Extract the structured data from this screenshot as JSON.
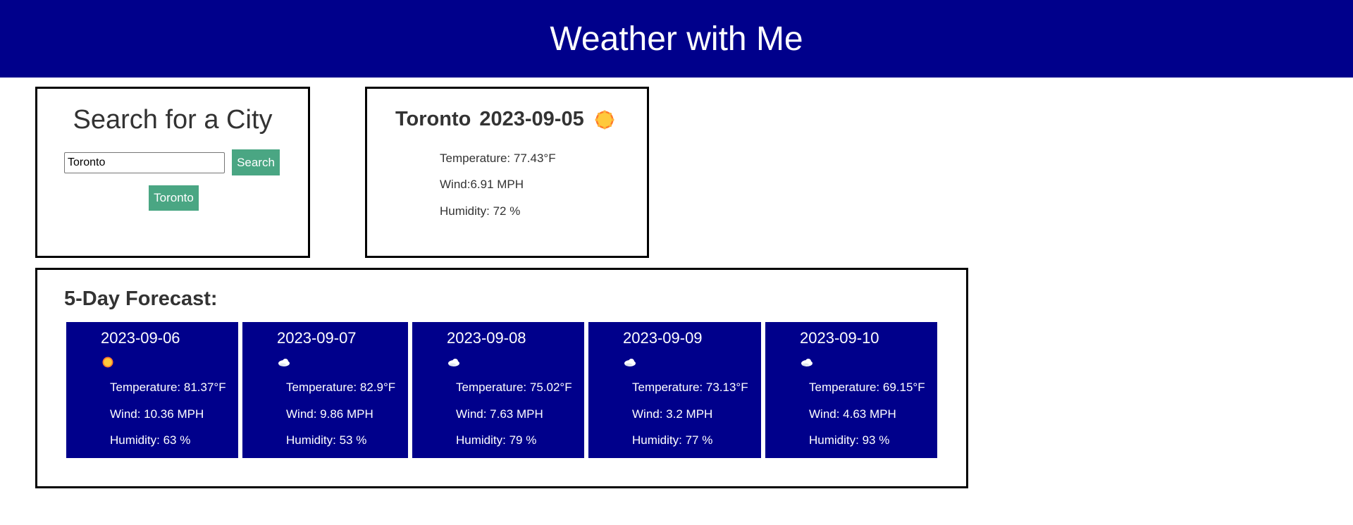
{
  "header": {
    "title": "Weather with Me"
  },
  "search": {
    "heading": "Search for a City",
    "input_value": "Toronto",
    "button_label": "Search",
    "history": [
      "Toronto"
    ]
  },
  "current": {
    "city": "Toronto",
    "date": "2023-09-05",
    "icon": "sun-icon",
    "temperature": "Temperature: 77.43°F",
    "wind": "Wind:6.91 MPH",
    "humidity": "Humidity: 72 %"
  },
  "forecast": {
    "heading": "5-Day Forecast:",
    "days": [
      {
        "date": "2023-09-06",
        "icon": "sun-icon",
        "temperature": "Temperature: 81.37°F",
        "wind": "Wind: 10.36 MPH",
        "humidity": "Humidity: 63 %"
      },
      {
        "date": "2023-09-07",
        "icon": "cloud-icon",
        "temperature": "Temperature: 82.9°F",
        "wind": "Wind: 9.86 MPH",
        "humidity": "Humidity: 53 %"
      },
      {
        "date": "2023-09-08",
        "icon": "cloud-icon",
        "temperature": "Temperature: 75.02°F",
        "wind": "Wind: 7.63 MPH",
        "humidity": "Humidity: 79 %"
      },
      {
        "date": "2023-09-09",
        "icon": "cloud-icon",
        "temperature": "Temperature: 73.13°F",
        "wind": "Wind: 3.2 MPH",
        "humidity": "Humidity: 77 %"
      },
      {
        "date": "2023-09-10",
        "icon": "cloud-icon",
        "temperature": "Temperature: 69.15°F",
        "wind": "Wind: 4.63 MPH",
        "humidity": "Humidity: 93 %"
      }
    ]
  },
  "colors": {
    "header_bg": "#00008b",
    "button_bg": "#4aa683",
    "card_bg": "#00008b"
  }
}
